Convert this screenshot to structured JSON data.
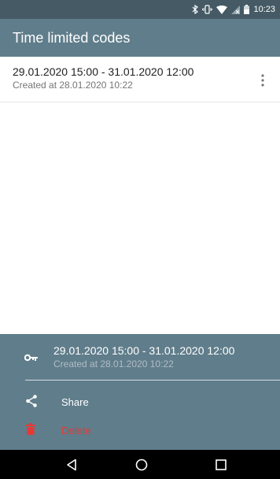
{
  "status_bar": {
    "time": "10:23",
    "icons": [
      "bluetooth-icon",
      "vibrate-icon",
      "wifi-icon",
      "no-sim-icon",
      "battery-icon"
    ]
  },
  "app_bar": {
    "title": "Time limited codes",
    "background": "#607d8b"
  },
  "codes": [
    {
      "range": "29.01.2020 15:00 - 31.01.2020 12:00",
      "created": "Created at 28.01.2020 10:22",
      "menu_icon": "more-vert-icon"
    }
  ],
  "bottom_sheet": {
    "icon": "key-icon",
    "range": "29.01.2020 15:00 - 31.01.2020 12:00",
    "created": "Created at 28.01.2020 10:22",
    "actions": [
      {
        "label": "Share",
        "icon": "share-icon",
        "color": "#ffffff"
      },
      {
        "label": "Delete",
        "icon": "trash-icon",
        "color": "#e53935"
      }
    ]
  },
  "nav_bar": {
    "buttons": [
      "back-icon",
      "home-icon",
      "recents-icon"
    ]
  }
}
